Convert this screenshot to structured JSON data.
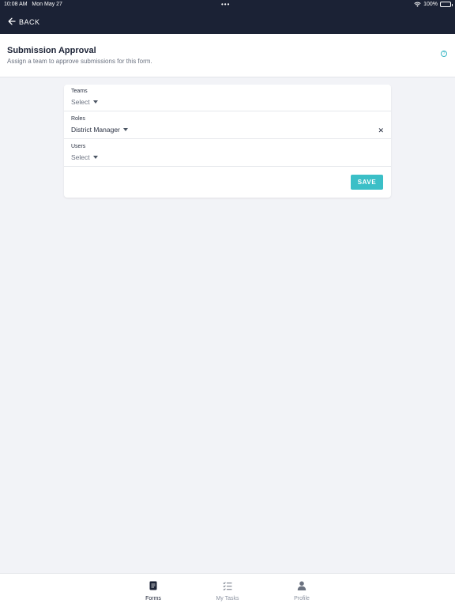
{
  "status_bar": {
    "time": "10:08 AM",
    "date": "Mon May 27",
    "dots": "•••",
    "battery": "100%"
  },
  "header": {
    "back_label": "BACK"
  },
  "title_section": {
    "title": "Submission Approval",
    "subtitle": "Assign a team to approve submissions for this form.",
    "help_icon": "?"
  },
  "form": {
    "fields": [
      {
        "label": "Teams",
        "value": "Select",
        "filled": false
      },
      {
        "label": "Roles",
        "value": "District Manager",
        "filled": true,
        "clear": "✕"
      },
      {
        "label": "Users",
        "value": "Select",
        "filled": false
      }
    ],
    "save_label": "SAVE"
  },
  "tabs": [
    {
      "label": "Forms",
      "icon": "document-icon",
      "active": true
    },
    {
      "label": "My Tasks",
      "icon": "checklist-icon",
      "active": false
    },
    {
      "label": "Profile",
      "icon": "person-icon",
      "active": false
    }
  ],
  "colors": {
    "header_bg": "#1b2235",
    "accent": "#3bbfc7",
    "page_bg": "#f2f3f7"
  }
}
